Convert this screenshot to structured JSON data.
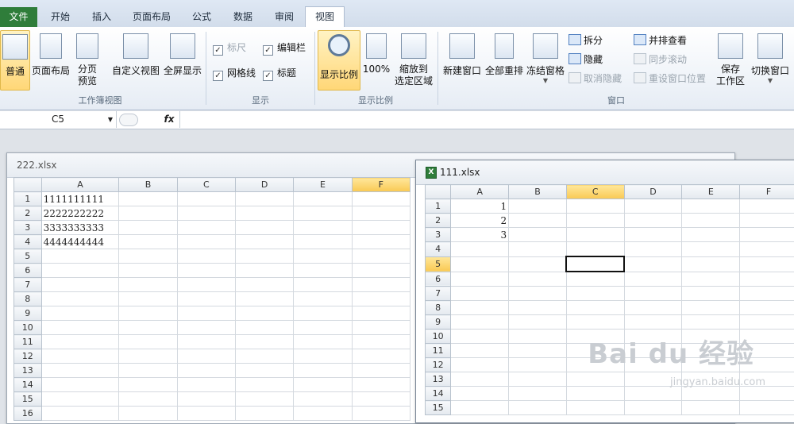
{
  "tabs": [
    "文件",
    "开始",
    "插入",
    "页面布局",
    "公式",
    "数据",
    "审阅",
    "视图"
  ],
  "ribbon": {
    "workbook_views": {
      "label": "工作簿视图",
      "normal": "普通",
      "page_layout": "页面布局",
      "page_break_1": "分页",
      "page_break_2": "预览",
      "custom": "自定义视图",
      "fullscreen": "全屏显示"
    },
    "show": {
      "label": "显示",
      "ruler": "标尺",
      "gridlines": "网格线",
      "formula_bar": "编辑栏",
      "headings": "标题"
    },
    "zoom": {
      "label": "显示比例",
      "zoom": "显示比例",
      "hundred": "100%",
      "zoom_sel_1": "缩放到",
      "zoom_sel_2": "选定区域"
    },
    "window": {
      "label": "窗口",
      "new_window": "新建窗口",
      "arrange_all": "全部重排",
      "freeze": "冻结窗格",
      "split": "拆分",
      "hide": "隐藏",
      "unhide": "取消隐藏",
      "side_by_side": "并排查看",
      "sync_scroll": "同步滚动",
      "reset_pos": "重设窗口位置",
      "save_ws_1": "保存",
      "save_ws_2": "工作区",
      "switch": "切换窗口"
    }
  },
  "formula_bar": {
    "name_box": "C5",
    "fx": "fx",
    "content": ""
  },
  "win1": {
    "title": "222.xlsx",
    "columns": [
      "A",
      "B",
      "C",
      "D",
      "E",
      "F"
    ],
    "rows": [
      "1",
      "2",
      "3",
      "4",
      "5",
      "6",
      "7",
      "8",
      "9",
      "10",
      "11",
      "12",
      "13",
      "14",
      "15",
      "16"
    ],
    "values": [
      "1111111111",
      "2222222222",
      "3333333333",
      "4444444444"
    ]
  },
  "win2": {
    "title": "111.xlsx",
    "columns": [
      "A",
      "B",
      "C",
      "D",
      "E",
      "F"
    ],
    "rows": [
      "1",
      "2",
      "3",
      "4",
      "5",
      "6",
      "7",
      "8",
      "9",
      "10",
      "11",
      "12",
      "13",
      "14",
      "15"
    ],
    "values": [
      "1",
      "2",
      "3"
    ]
  },
  "watermark": {
    "logo": "Bai du 经验",
    "url": "jingyan.baidu.com"
  }
}
